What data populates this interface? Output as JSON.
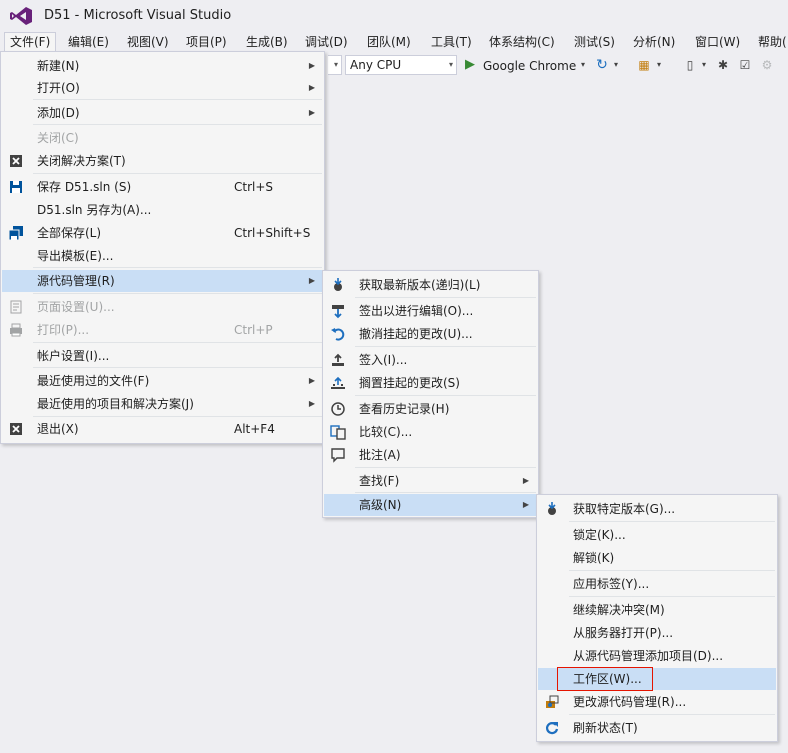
{
  "window": {
    "title": "D51 - Microsoft Visual Studio"
  },
  "menubar": [
    "文件(F)",
    "编辑(E)",
    "视图(V)",
    "项目(P)",
    "生成(B)",
    "调试(D)",
    "团队(M)",
    "工具(T)",
    "体系结构(C)",
    "测试(S)",
    "分析(N)",
    "窗口(W)",
    "帮助("
  ],
  "toolbar": {
    "platform": "Any CPU",
    "browser": "Google Chrome"
  },
  "file_menu": {
    "items": [
      {
        "label": "新建(N)",
        "has_sub": true
      },
      {
        "label": "打开(O)",
        "has_sub": true
      },
      {
        "label": "添加(D)",
        "has_sub": true
      },
      {
        "label": "关闭(C)",
        "disabled": true
      },
      {
        "label": "关闭解决方案(T)",
        "icon": "close-solution-icon"
      },
      {
        "label": "保存 D51.sln (S)",
        "shortcut": "Ctrl+S",
        "icon": "save-icon"
      },
      {
        "label": "D51.sln 另存为(A)..."
      },
      {
        "label": "全部保存(L)",
        "shortcut": "Ctrl+Shift+S",
        "icon": "save-all-icon"
      },
      {
        "label": "导出模板(E)..."
      },
      {
        "label": "源代码管理(R)",
        "has_sub": true,
        "highlighted": true
      },
      {
        "label": "页面设置(U)...",
        "disabled": true,
        "icon": "page-setup-icon"
      },
      {
        "label": "打印(P)...",
        "shortcut": "Ctrl+P",
        "disabled": true,
        "icon": "print-icon"
      },
      {
        "label": "帐户设置(I)..."
      },
      {
        "label": "最近使用过的文件(F)",
        "has_sub": true
      },
      {
        "label": "最近使用的项目和解决方案(J)",
        "has_sub": true
      },
      {
        "label": "退出(X)",
        "shortcut": "Alt+F4",
        "icon": "exit-icon"
      }
    ]
  },
  "source_control_menu": {
    "items": [
      {
        "label": "获取最新版本(递归)(L)",
        "icon": "get-latest-icon"
      },
      {
        "label": "签出以进行编辑(O)...",
        "icon": "checkout-icon"
      },
      {
        "label": "撤消挂起的更改(U)...",
        "icon": "undo-icon"
      },
      {
        "label": "签入(I)...",
        "icon": "checkin-icon"
      },
      {
        "label": "搁置挂起的更改(S)",
        "icon": "shelve-icon"
      },
      {
        "label": "查看历史记录(H)",
        "icon": "history-icon"
      },
      {
        "label": "比较(C)...",
        "icon": "compare-icon"
      },
      {
        "label": "批注(A)",
        "icon": "annotate-icon"
      },
      {
        "label": "查找(F)",
        "has_sub": true
      },
      {
        "label": "高级(N)",
        "has_sub": true,
        "highlighted": true
      }
    ]
  },
  "advanced_menu": {
    "items": [
      {
        "label": "获取特定版本(G)...",
        "icon": "get-specific-icon"
      },
      {
        "label": "锁定(K)..."
      },
      {
        "label": "解锁(K)"
      },
      {
        "label": "应用标签(Y)..."
      },
      {
        "label": "继续解决冲突(M)"
      },
      {
        "label": "从服务器打开(P)..."
      },
      {
        "label": "从源代码管理添加项目(D)..."
      },
      {
        "label": "工作区(W)...",
        "highlighted": true,
        "boxed": true
      },
      {
        "label": "更改源代码管理(R)...",
        "icon": "change-source-control-icon"
      },
      {
        "label": "刷新状态(T)",
        "icon": "refresh-icon"
      }
    ]
  },
  "colors": {
    "highlight": "#c9def5",
    "menu_bg": "#f5f5f5",
    "red_box": "#e51400",
    "vs_purple": "#68217a"
  }
}
